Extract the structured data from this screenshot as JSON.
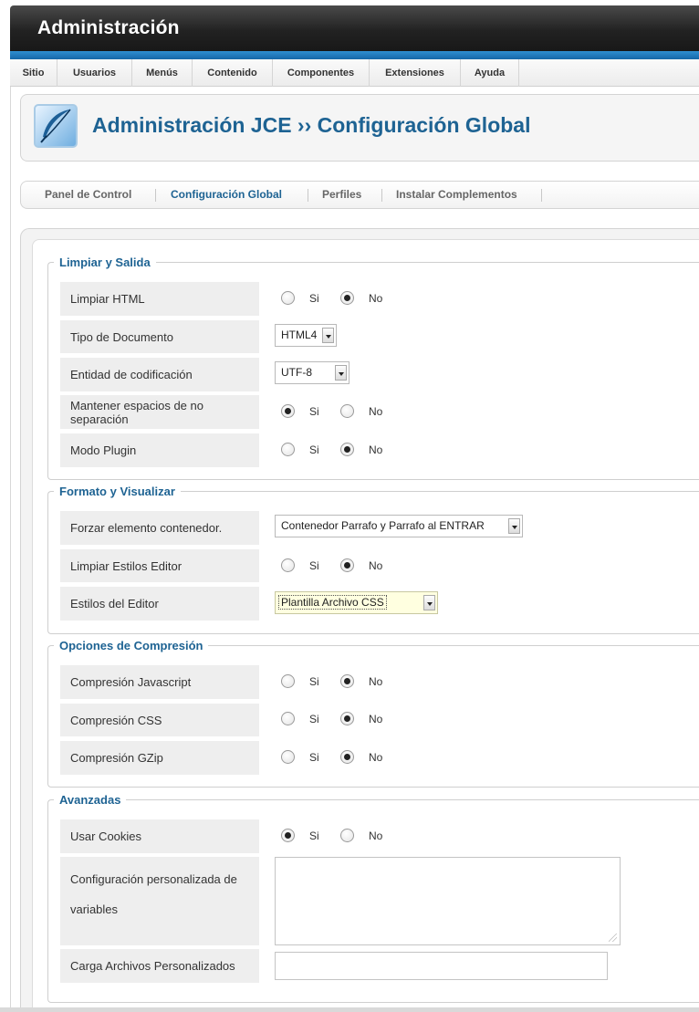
{
  "window": {
    "title": "Administración"
  },
  "menu": [
    {
      "label": "Sitio"
    },
    {
      "label": "Usuarios"
    },
    {
      "label": "Menús"
    },
    {
      "label": "Contenido"
    },
    {
      "label": "Componentes"
    },
    {
      "label": "Extensiones"
    },
    {
      "label": "Ayuda"
    }
  ],
  "header": {
    "title": "Administración JCE ›› Configuración Global",
    "logo_icon": "feather-quill-icon"
  },
  "tabs": [
    {
      "label": "Panel de Control",
      "active": false
    },
    {
      "label": "Configuración Global",
      "active": true
    },
    {
      "label": "Perfiles",
      "active": false
    },
    {
      "label": "Instalar Complementos",
      "active": false
    }
  ],
  "sections": {
    "cleanup": {
      "legend": "Limpiar y Salida",
      "rows": {
        "limpiar_html": {
          "label": "Limpiar HTML",
          "yes": "Si",
          "no": "No",
          "value": "No"
        },
        "tipo_documento": {
          "label": "Tipo de Documento",
          "value": "HTML4"
        },
        "entidad": {
          "label": "Entidad de codificación",
          "value": "UTF-8"
        },
        "espacios": {
          "label": "Mantener espacios de no separación",
          "yes": "Si",
          "no": "No",
          "value": "Si"
        },
        "modo_plugin": {
          "label": "Modo Plugin",
          "yes": "Si",
          "no": "No",
          "value": "No"
        }
      }
    },
    "format": {
      "legend": "Formato y Visualizar",
      "rows": {
        "forzar": {
          "label": "Forzar elemento contenedor.",
          "value": "Contenedor Parrafo y Parrafo al ENTRAR"
        },
        "limpiar_estilos": {
          "label": "Limpiar Estilos Editor",
          "yes": "Si",
          "no": "No",
          "value": "No"
        },
        "estilos": {
          "label": "Estilos del Editor",
          "value": "Plantilla Archivo CSS"
        }
      }
    },
    "compression": {
      "legend": "Opciones de Compresión",
      "rows": {
        "js": {
          "label": "Compresión Javascript",
          "yes": "Si",
          "no": "No",
          "value": "No"
        },
        "css": {
          "label": "Compresión CSS",
          "yes": "Si",
          "no": "No",
          "value": "No"
        },
        "gzip": {
          "label": "Compresión GZip",
          "yes": "Si",
          "no": "No",
          "value": "No"
        }
      }
    },
    "advanced": {
      "legend": "Avanzadas",
      "rows": {
        "cookies": {
          "label": "Usar Cookies",
          "yes": "Si",
          "no": "No",
          "value": "Si"
        },
        "custom_config": {
          "label": "Configuración personalizada de variables",
          "value": ""
        },
        "custom_files": {
          "label": "Carga Archivos Personalizados",
          "value": ""
        }
      }
    }
  },
  "colors": {
    "accent": "#1e6393",
    "topbar": "#222222",
    "bluebar": "#1d75b9",
    "label_bg": "#eeeeee"
  }
}
